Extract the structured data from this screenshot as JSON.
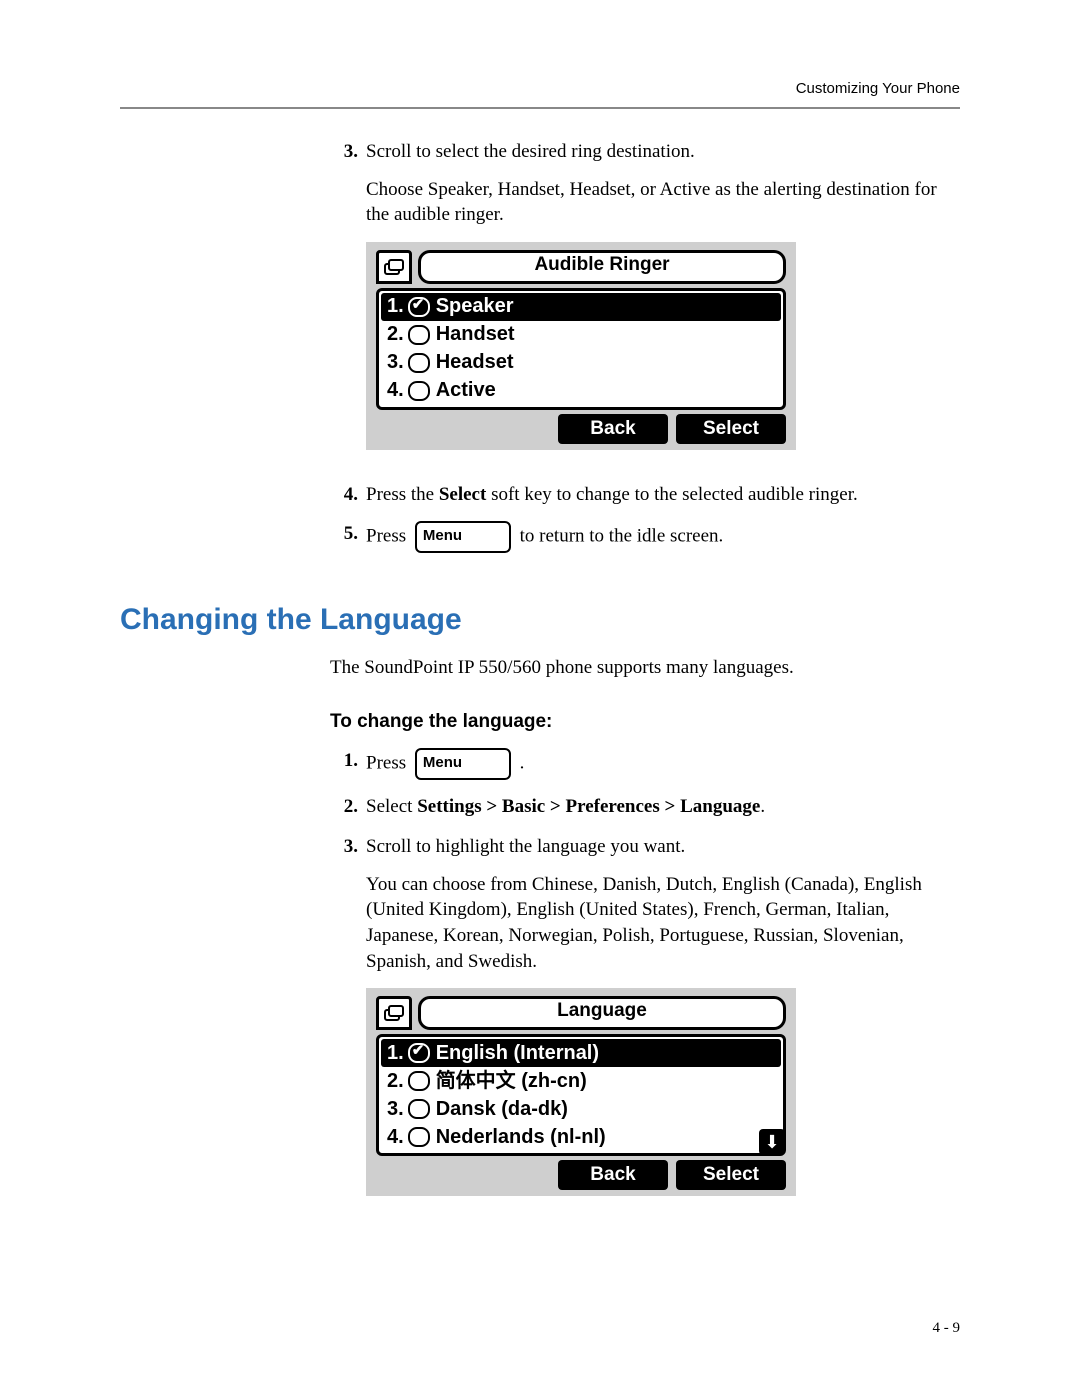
{
  "running_head": "Customizing Your Phone",
  "steps_a": {
    "s3": {
      "num": "3.",
      "line1": "Scroll to select the desired ring destination.",
      "line2": "Choose Speaker, Handset, Headset, or Active as the alerting destination for the audible ringer."
    },
    "s4": {
      "num": "4.",
      "pre": "Press the ",
      "bold": "Select",
      "post": " soft key to change to the selected audible ringer."
    },
    "s5": {
      "num": "5.",
      "pre": "Press ",
      "key": "Menu",
      "post": " to return to the idle screen."
    }
  },
  "lcd1": {
    "title": "Audible Ringer",
    "rows": [
      {
        "idx": "1.",
        "label": "Speaker",
        "selected": true
      },
      {
        "idx": "2.",
        "label": "Handset",
        "selected": false
      },
      {
        "idx": "3.",
        "label": "Headset",
        "selected": false
      },
      {
        "idx": "4.",
        "label": "Active",
        "selected": false
      }
    ],
    "soft": {
      "back": "Back",
      "select": "Select"
    }
  },
  "section_title": "Changing the Language",
  "section_intro": "The SoundPoint IP 550/560 phone supports many languages.",
  "subhead": "To change the language:",
  "steps_b": {
    "s1": {
      "num": "1.",
      "pre": "Press ",
      "key": "Menu",
      "post": " ."
    },
    "s2": {
      "num": "2.",
      "pre": "Select ",
      "bold": "Settings > Basic > Preferences > Language",
      "post": "."
    },
    "s3": {
      "num": "3.",
      "line1": "Scroll to highlight the language you want.",
      "line2": "You can choose from Chinese, Danish, Dutch, English (Canada), English (United Kingdom), English (United States), French, German, Italian, Japanese, Korean, Norwegian, Polish, Portuguese, Russian, Slovenian, Spanish, and Swedish."
    }
  },
  "lcd2": {
    "title": "Language",
    "rows": [
      {
        "idx": "1.",
        "label": "English (Internal)",
        "selected": true
      },
      {
        "idx": "2.",
        "label": "简体中文 (zh-cn)",
        "selected": false
      },
      {
        "idx": "3.",
        "label": "Dansk (da-dk)",
        "selected": false
      },
      {
        "idx": "4.",
        "label": "Nederlands (nl-nl)",
        "selected": false
      }
    ],
    "soft": {
      "back": "Back",
      "select": "Select"
    }
  },
  "page_num": "4 - 9"
}
